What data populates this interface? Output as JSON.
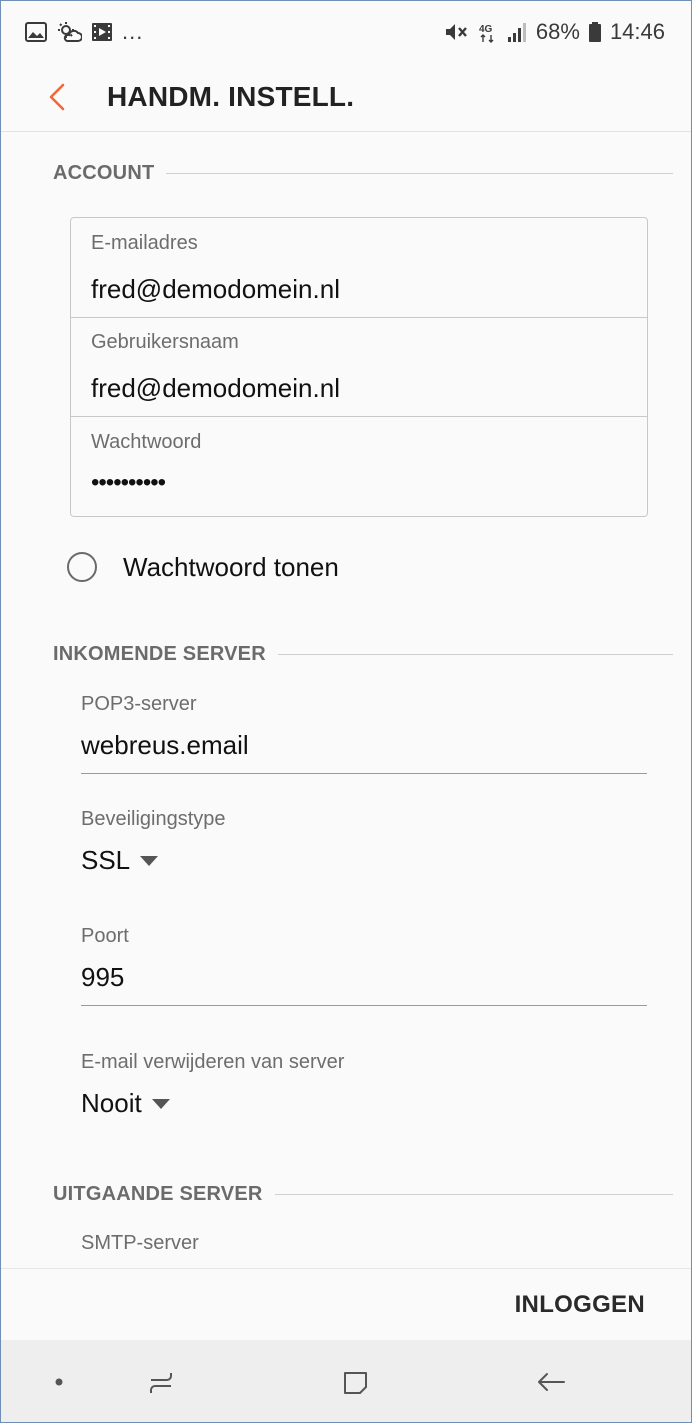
{
  "status_bar": {
    "left_dots": "...",
    "network": "4G",
    "battery": "68%",
    "time": "14:46"
  },
  "header": {
    "title": "HANDM. INSTELL.",
    "back_icon": "chevron-left-icon",
    "accent": "#f0683a"
  },
  "account": {
    "section_label": "ACCOUNT",
    "email": {
      "label": "E-mailadres",
      "value": "fred@demodomein.nl"
    },
    "username": {
      "label": "Gebruikersnaam",
      "value": "fred@demodomein.nl"
    },
    "password": {
      "label": "Wachtwoord",
      "value": "••••••••••"
    },
    "show_password": {
      "label": "Wachtwoord tonen",
      "checked": false
    }
  },
  "incoming": {
    "section_label": "INKOMENDE SERVER",
    "server": {
      "label": "POP3-server",
      "value": "webreus.email"
    },
    "security": {
      "label": "Beveiligingstype",
      "value": "SSL"
    },
    "port": {
      "label": "Poort",
      "value": "995"
    },
    "delete": {
      "label": "E-mail verwijderen van server",
      "value": "Nooit"
    }
  },
  "outgoing": {
    "section_label": "UITGAANDE SERVER",
    "server": {
      "label": "SMTP-server"
    }
  },
  "actions": {
    "login_label": "INLOGGEN"
  },
  "nav": {
    "dot": "•"
  }
}
